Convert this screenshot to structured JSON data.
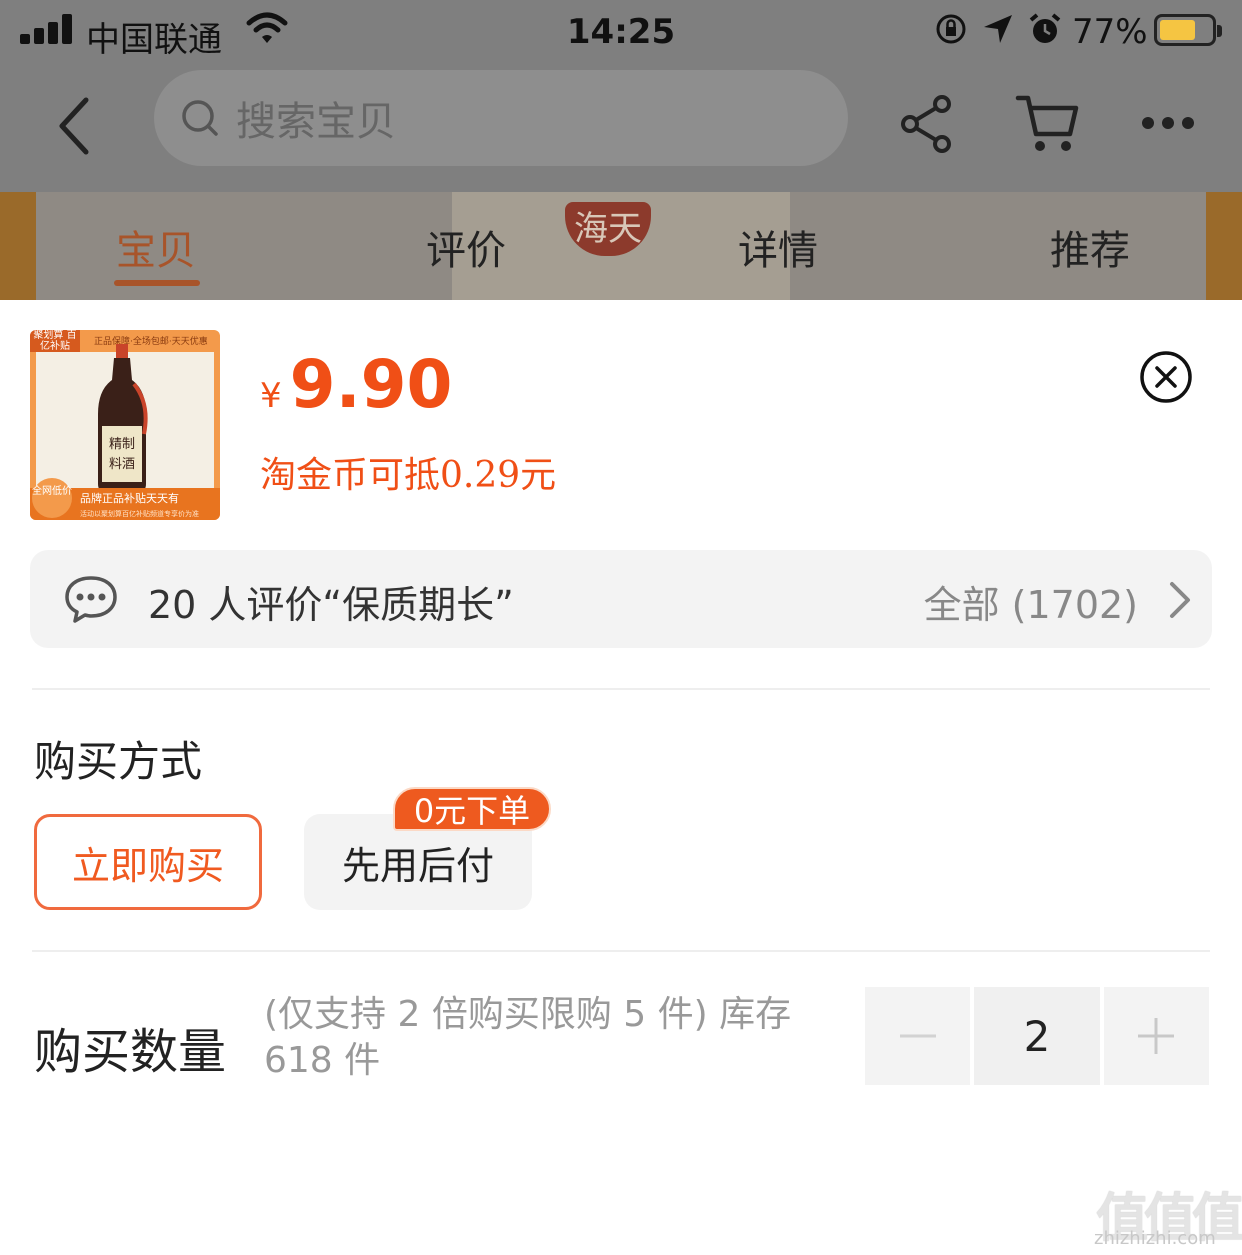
{
  "status_bar": {
    "carrier": "中国联通",
    "time": "14:25",
    "battery_percent": "77%",
    "battery_color": "#f5c542"
  },
  "header": {
    "search_placeholder": "搜索宝贝",
    "icons": [
      "back-icon",
      "search-icon",
      "share-icon",
      "cart-icon",
      "more-icon"
    ]
  },
  "tabs": [
    {
      "label": "宝贝",
      "active": true
    },
    {
      "label": "评价",
      "active": false
    },
    {
      "label": "详情",
      "active": false
    },
    {
      "label": "推荐",
      "active": false
    }
  ],
  "background_image": {
    "brand_seal": "海天"
  },
  "product": {
    "price_currency": "¥",
    "price": "9.90",
    "coin_discount": "淘金币可抵0.29元",
    "thumb": {
      "badge": "聚划算 百亿补贴",
      "tagline": "正品保障·全场包邮·天天优惠",
      "bottle_label": "精制料酒",
      "bottom_text": "品牌正品补贴天天有",
      "bottom_sub": "活动以聚划算百亿补贴频道专享价为准",
      "corner_badge": "全网低价"
    }
  },
  "reviews": {
    "summary": "20 人评价“保质期长”",
    "all_label": "全部 (1702)"
  },
  "purchase_method": {
    "title": "购买方式",
    "options": [
      {
        "label": "立即购买",
        "selected": true
      },
      {
        "label": "先用后付",
        "selected": false,
        "badge": "0元下单"
      }
    ]
  },
  "quantity": {
    "title": "购买数量",
    "note": "(仅支持 2 倍购买限购 5 件) 库存 618 件",
    "value": "2",
    "decrement": "−",
    "increment": "+"
  },
  "watermark": {
    "glyphs": "值值值",
    "url": "zhizhizhi.com"
  },
  "colors": {
    "accent": "#f04f16",
    "dim_overlay": "#7f7f7f"
  }
}
